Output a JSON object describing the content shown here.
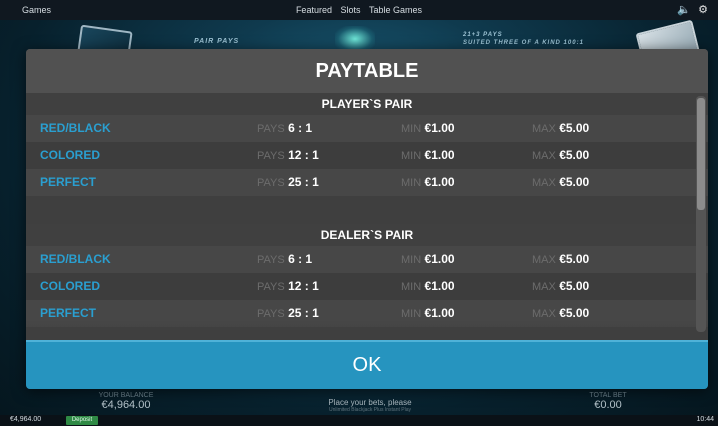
{
  "topbar": {
    "games": "Games",
    "nav": [
      "Featured",
      "Slots",
      "Table Games"
    ],
    "sound_icon": "speaker-icon",
    "settings_icon": "gear-icon"
  },
  "background": {
    "pair_pays": "PAIR PAYS",
    "sidebet_title": "21+3 PAYS",
    "sidebet_sub": "SUITED THREE OF A KIND  100:1"
  },
  "modal": {
    "title": "PAYTABLE",
    "ok_label": "OK",
    "sections": [
      {
        "title": "PLAYER`S PAIR",
        "rows": [
          {
            "name": "RED/BLACK",
            "pays_label": "PAYS",
            "pays": "6 : 1",
            "min_label": "MIN",
            "min": "€1.00",
            "max_label": "MAX",
            "max": "€5.00"
          },
          {
            "name": "COLORED",
            "pays_label": "PAYS",
            "pays": "12 : 1",
            "min_label": "MIN",
            "min": "€1.00",
            "max_label": "MAX",
            "max": "€5.00"
          },
          {
            "name": "PERFECT",
            "pays_label": "PAYS",
            "pays": "25 : 1",
            "min_label": "MIN",
            "min": "€1.00",
            "max_label": "MAX",
            "max": "€5.00"
          }
        ]
      },
      {
        "title": "DEALER`S PAIR",
        "rows": [
          {
            "name": "RED/BLACK",
            "pays_label": "PAYS",
            "pays": "6 : 1",
            "min_label": "MIN",
            "min": "€1.00",
            "max_label": "MAX",
            "max": "€5.00"
          },
          {
            "name": "COLORED",
            "pays_label": "PAYS",
            "pays": "12 : 1",
            "min_label": "MIN",
            "min": "€1.00",
            "max_label": "MAX",
            "max": "€5.00"
          },
          {
            "name": "PERFECT",
            "pays_label": "PAYS",
            "pays": "25 : 1",
            "min_label": "MIN",
            "min": "€1.00",
            "max_label": "MAX",
            "max": "€5.00"
          }
        ]
      }
    ]
  },
  "status": {
    "balance_label": "YOUR BALANCE",
    "balance": "€4,964.00",
    "message": "Place your bets, please",
    "submessage": "Unlimited Blackjack Plus Instant Play",
    "total_bet_label": "TOTAL BET",
    "total_bet": "€0.00"
  },
  "bottombar": {
    "balance": "€4,964.00",
    "deposit": "Deposit",
    "time": "10:44"
  },
  "colors": {
    "accent": "#2694bf",
    "row_name": "#2a9fd0",
    "panel": "#3f3f3f"
  }
}
